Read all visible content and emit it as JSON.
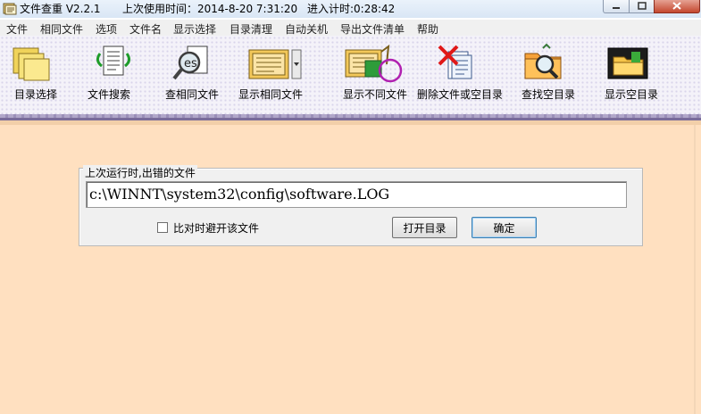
{
  "window": {
    "title": "文件查重 V2.2.1",
    "last_use": "上次使用时间：2014-8-20  7:31:20",
    "timer": "进入计时:0:28:42"
  },
  "menu": {
    "items": [
      "文件",
      "相同文件",
      "选项",
      "文件名",
      "显示选择",
      "目录清理",
      "自动关机",
      "导出文件清单",
      "帮助"
    ]
  },
  "toolbar": {
    "buttons": [
      {
        "label": "目录选择",
        "icon": "folders-icon"
      },
      {
        "label": "文件搜索",
        "icon": "file-search-icon"
      },
      {
        "label": "查相同文件",
        "icon": "magnifier-icon"
      },
      {
        "label": "显示相同文件",
        "icon": "same-files-icon"
      },
      {
        "label": "显示不同文件",
        "icon": "diff-files-icon"
      },
      {
        "label": "删除文件或空目录",
        "icon": "delete-file-icon"
      },
      {
        "label": "查找空目录",
        "icon": "find-empty-folder-icon"
      },
      {
        "label": "显示空目录",
        "icon": "show-empty-folder-icon"
      }
    ]
  },
  "dialog": {
    "group_title": "上次运行时,出错的文件",
    "path_value": "c:\\WINNT\\system32\\config\\software.LOG",
    "skip_checkbox_label": "比对时避开该文件",
    "skip_checked": false,
    "open_dir_button": "打开目录",
    "ok_button": "确定"
  },
  "colors": {
    "main_background": "#ffe0c0",
    "toolbar_background": "#f4f2f9",
    "highlight_circle": "#b020b0"
  }
}
